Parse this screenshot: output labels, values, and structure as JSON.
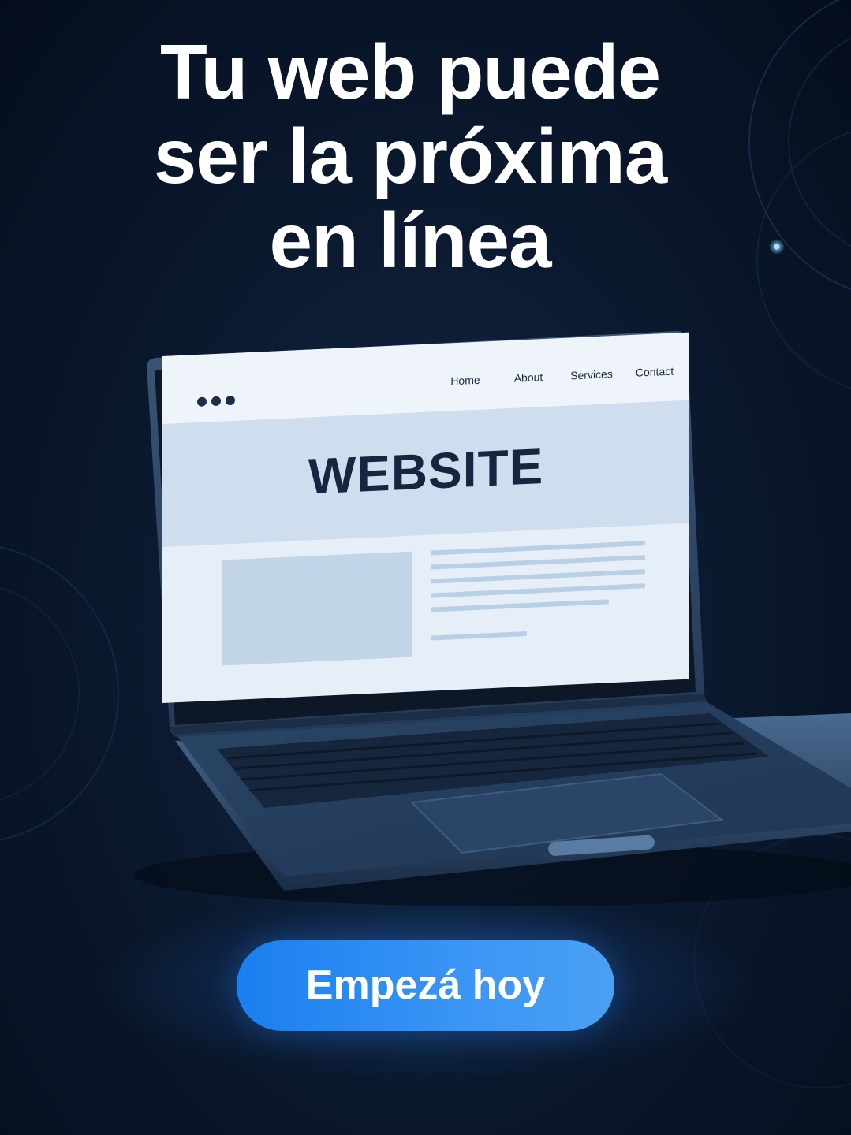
{
  "headline": {
    "line1": "Tu web puede",
    "line2": "ser la próxima",
    "line3": "en línea"
  },
  "laptop_screen": {
    "nav": [
      "Home",
      "About",
      "Services",
      "Contact"
    ],
    "hero_title": "WEBSITE",
    "icons": {
      "menu_dots": "three-dots-icon"
    }
  },
  "cta": {
    "label": "Empezá hoy"
  },
  "colors": {
    "background": "#0b1a30",
    "button": "#2a8cf2",
    "text": "#ffffff",
    "screen_title": "#152640"
  }
}
